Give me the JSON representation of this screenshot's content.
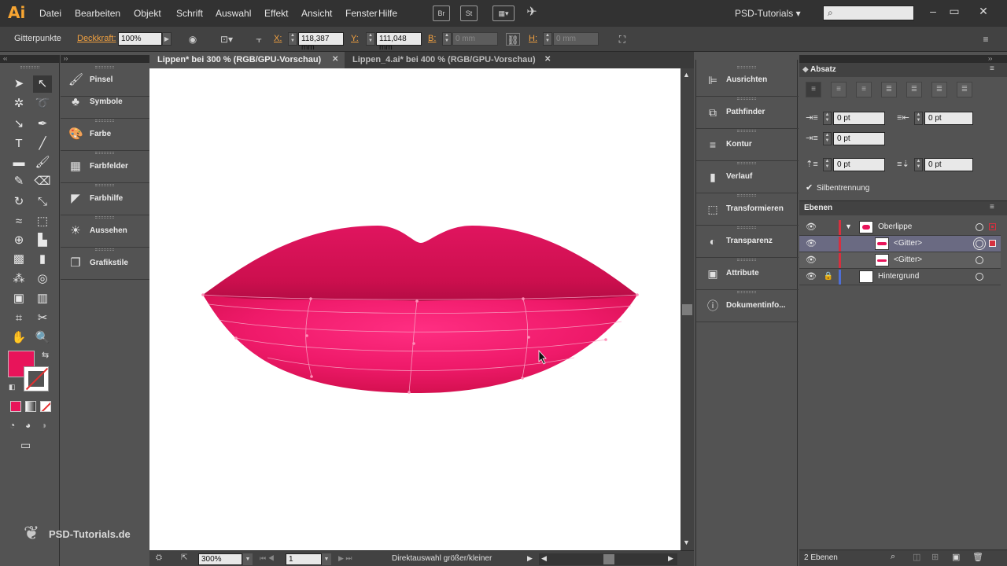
{
  "app": {
    "logo": "Ai",
    "menu": [
      "Datei",
      "Bearbeiten",
      "Objekt",
      "Schrift",
      "Auswahl",
      "Effekt",
      "Ansicht",
      "Fenster",
      "Hilfe"
    ],
    "bridge_label": "Br",
    "stock_label": "St",
    "workspace": "PSD-Tutorials",
    "window_controls": [
      "minimize-icon",
      "maximize-icon",
      "close-icon"
    ]
  },
  "control_bar": {
    "selection_type": "Gitterpunkte",
    "opacity_label": "Deckkraft:",
    "opacity_value": "100%",
    "x_label": "X:",
    "x_value": "118,387 mm",
    "y_label": "Y:",
    "y_value": "111,048 mm",
    "w_label": "B:",
    "w_value": "0 mm",
    "h_label": "H:",
    "h_value": "0 mm"
  },
  "left_panels": [
    {
      "label": "Pinsel",
      "icon": "brush-icon"
    },
    {
      "label": "Symbole",
      "icon": "symbols-icon"
    },
    {
      "label": "Farbe",
      "icon": "palette-icon"
    },
    {
      "label": "Farbfelder",
      "icon": "swatches-icon"
    },
    {
      "label": "Farbhilfe",
      "icon": "color-guide-icon"
    },
    {
      "label": "Aussehen",
      "icon": "appearance-icon"
    },
    {
      "label": "Grafikstile",
      "icon": "graphic-styles-icon"
    }
  ],
  "tabs": [
    {
      "label": "Lippen* bei 300 % (RGB/GPU-Vorschau)",
      "active": true
    },
    {
      "label": "Lippen_4.ai* bei 400 % (RGB/GPU-Vorschau)",
      "active": false
    }
  ],
  "status_bar": {
    "zoom": "300%",
    "artboard": "1",
    "tool_hint": "Direktauswahl größer/kleiner"
  },
  "mid_panels": [
    {
      "label": "Ausrichten",
      "icon": "align-icon"
    },
    {
      "label": "Pathfinder",
      "icon": "pathfinder-icon"
    },
    {
      "label": "Kontur",
      "icon": "stroke-icon"
    },
    {
      "label": "Verlauf",
      "icon": "gradient-icon"
    },
    {
      "label": "Transformieren",
      "icon": "transform-icon"
    },
    {
      "label": "Transparenz",
      "icon": "transparency-icon"
    },
    {
      "label": "Attribute",
      "icon": "attributes-icon"
    },
    {
      "label": "Dokumentinfo...",
      "icon": "document-info-icon"
    }
  ],
  "absatz": {
    "title": "Absatz",
    "left_indent": "0 pt",
    "right_indent": "0 pt",
    "first_line_indent": "0 pt",
    "space_before": "0 pt",
    "space_after": "0 pt",
    "hyphenation_label": "Silbentrennung",
    "hyphenation_checked": true
  },
  "layers": {
    "title": "Ebenen",
    "rows": [
      {
        "name": "Oberlippe",
        "locked": false,
        "color": "#d6303f"
      },
      {
        "name": "<Gitter>",
        "locked": false,
        "color": "#d6303f"
      },
      {
        "name": "<Gitter>",
        "locked": false,
        "color": "#d6303f"
      },
      {
        "name": "Hintergrund",
        "locked": true,
        "color": "#4f6fd6"
      }
    ],
    "count": "2 Ebenen"
  },
  "watermark": "PSD-Tutorials.de",
  "colors": {
    "fill": "#e8145a",
    "accent_orange": "#f0a040"
  }
}
